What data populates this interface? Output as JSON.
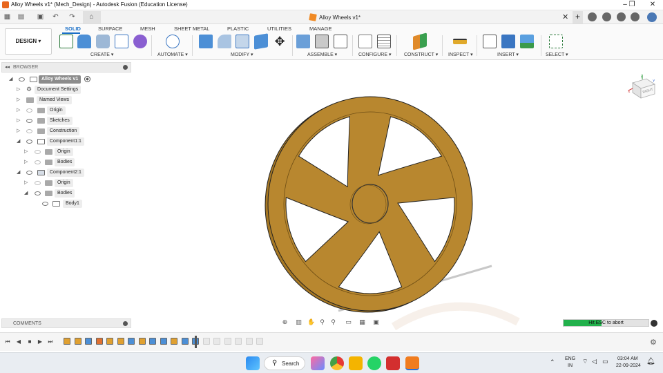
{
  "window": {
    "title": "Alloy Wheels v1* (Mech_Design) - Autodesk Fusion (Education License)",
    "controls": [
      "minimize-icon",
      "restore-icon",
      "close-icon"
    ]
  },
  "document_tab": {
    "label": "Alloy Wheels v1*",
    "close_label": "✕",
    "add_label": "+"
  },
  "ribbon": {
    "workspace_label": "DESIGN ▾",
    "tabs": [
      "SOLID",
      "SURFACE",
      "MESH",
      "SHEET METAL",
      "PLASTIC",
      "UTILITIES",
      "MANAGE"
    ],
    "active_tab": "SOLID",
    "groups": [
      "CREATE ▾",
      "AUTOMATE ▾",
      "MODIFY ▾",
      "ASSEMBLE ▾",
      "CONFIGURE ▾",
      "CONSTRUCT ▾",
      "INSPECT ▾",
      "INSERT ▾",
      "SELECT ▾"
    ]
  },
  "browser": {
    "title": "BROWSER",
    "items": [
      {
        "label": "Alloy Wheels v1",
        "arrow": "◢"
      },
      {
        "label": "Document Settings",
        "arrow": "▷"
      },
      {
        "label": "Named Views",
        "arrow": "▷"
      },
      {
        "label": "Origin",
        "arrow": "▷"
      },
      {
        "label": "Sketches",
        "arrow": "▷"
      },
      {
        "label": "Construction",
        "arrow": "▷"
      },
      {
        "label": "Component1:1",
        "arrow": "◢"
      },
      {
        "label": "Origin",
        "arrow": "▷"
      },
      {
        "label": "Bodies",
        "arrow": "▷"
      },
      {
        "label": "Component2:1",
        "arrow": "◢"
      },
      {
        "label": "Origin",
        "arrow": "▷"
      },
      {
        "label": "Bodies",
        "arrow": "◢"
      },
      {
        "label": "Body1",
        "arrow": ""
      }
    ]
  },
  "comments": {
    "title": "COMMENTS"
  },
  "viewcube": {
    "face_label": "RIGHT",
    "axis_z": "Z",
    "axis_x": "X",
    "axis_y": "Y"
  },
  "status": {
    "esc_message": "Hit ESC to abort",
    "progress": 0.45
  },
  "taskbar": {
    "search_label": "Search",
    "language_top": "ENG",
    "language_bottom": "IN",
    "time": "03:04 AM",
    "date": "22-09-2024"
  },
  "colors": {
    "wheel_face": "#b8872f",
    "wheel_rim": "#a67824",
    "accent": "#1a6fc7",
    "progress": "#22b14c"
  }
}
